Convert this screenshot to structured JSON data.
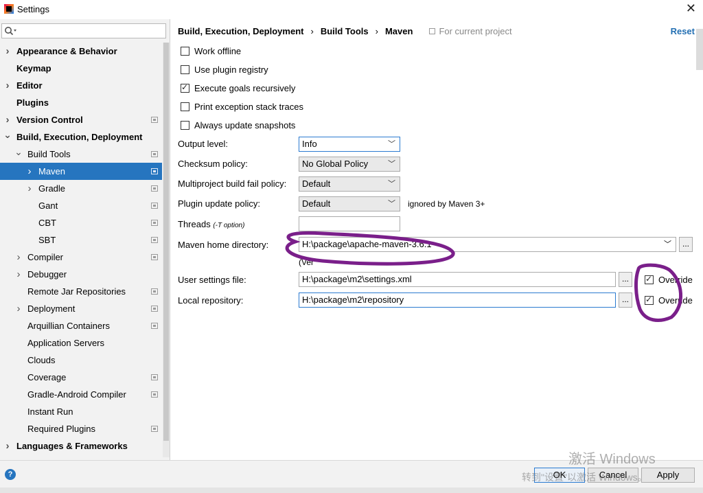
{
  "window": {
    "title": "Settings"
  },
  "search": {
    "placeholder": ""
  },
  "tree": [
    {
      "label": "Appearance & Behavior",
      "level": 0,
      "bold": true,
      "chevron": "right",
      "project": false
    },
    {
      "label": "Keymap",
      "level": 0,
      "bold": true,
      "chevron": "",
      "project": false
    },
    {
      "label": "Editor",
      "level": 0,
      "bold": true,
      "chevron": "right",
      "project": false
    },
    {
      "label": "Plugins",
      "level": 0,
      "bold": true,
      "chevron": "",
      "project": false
    },
    {
      "label": "Version Control",
      "level": 0,
      "bold": true,
      "chevron": "right",
      "project": true
    },
    {
      "label": "Build, Execution, Deployment",
      "level": 0,
      "bold": true,
      "chevron": "down",
      "project": false
    },
    {
      "label": "Build Tools",
      "level": 1,
      "bold": false,
      "chevron": "down",
      "project": true
    },
    {
      "label": "Maven",
      "level": 2,
      "bold": false,
      "chevron": "right",
      "project": true,
      "selected": true
    },
    {
      "label": "Gradle",
      "level": 2,
      "bold": false,
      "chevron": "right",
      "project": true
    },
    {
      "label": "Gant",
      "level": 2,
      "bold": false,
      "chevron": "",
      "project": true
    },
    {
      "label": "CBT",
      "level": 2,
      "bold": false,
      "chevron": "",
      "project": true
    },
    {
      "label": "SBT",
      "level": 2,
      "bold": false,
      "chevron": "",
      "project": true
    },
    {
      "label": "Compiler",
      "level": 1,
      "bold": false,
      "chevron": "right",
      "project": true
    },
    {
      "label": "Debugger",
      "level": 1,
      "bold": false,
      "chevron": "right",
      "project": false
    },
    {
      "label": "Remote Jar Repositories",
      "level": 1,
      "bold": false,
      "chevron": "",
      "project": true
    },
    {
      "label": "Deployment",
      "level": 1,
      "bold": false,
      "chevron": "right",
      "project": true
    },
    {
      "label": "Arquillian Containers",
      "level": 1,
      "bold": false,
      "chevron": "",
      "project": true
    },
    {
      "label": "Application Servers",
      "level": 1,
      "bold": false,
      "chevron": "",
      "project": false
    },
    {
      "label": "Clouds",
      "level": 1,
      "bold": false,
      "chevron": "",
      "project": false
    },
    {
      "label": "Coverage",
      "level": 1,
      "bold": false,
      "chevron": "",
      "project": true
    },
    {
      "label": "Gradle-Android Compiler",
      "level": 1,
      "bold": false,
      "chevron": "",
      "project": true
    },
    {
      "label": "Instant Run",
      "level": 1,
      "bold": false,
      "chevron": "",
      "project": false
    },
    {
      "label": "Required Plugins",
      "level": 1,
      "bold": false,
      "chevron": "",
      "project": true
    },
    {
      "label": "Languages & Frameworks",
      "level": 0,
      "bold": true,
      "chevron": "right",
      "project": false
    }
  ],
  "breadcrumb": {
    "items": [
      "Build, Execution, Deployment",
      "Build Tools",
      "Maven"
    ],
    "for_project": "For current project",
    "reset": "Reset"
  },
  "checkboxes": [
    {
      "label": "Work offline",
      "checked": false
    },
    {
      "label": "Use plugin registry",
      "checked": false
    },
    {
      "label": "Execute goals recursively",
      "checked": true
    },
    {
      "label": "Print exception stack traces",
      "checked": false
    },
    {
      "label": "Always update snapshots",
      "checked": false
    }
  ],
  "form": {
    "output_level": {
      "label": "Output level:",
      "value": "Info"
    },
    "checksum_policy": {
      "label": "Checksum policy:",
      "value": "No Global Policy"
    },
    "multiproject_policy": {
      "label": "Multiproject build fail policy:",
      "value": "Default"
    },
    "plugin_update_policy": {
      "label": "Plugin update policy:",
      "value": "Default",
      "note": "ignored by Maven 3+"
    },
    "threads": {
      "label": "Threads",
      "hint": "(-T option)",
      "value": ""
    },
    "maven_home": {
      "label": "Maven home directory:",
      "value": "H:\\package\\apache-maven-3.6.1",
      "version_note": "(Ver"
    },
    "user_settings": {
      "label": "User settings file:",
      "value": "H:\\package\\m2\\settings.xml",
      "override": "Override",
      "override_checked": true
    },
    "local_repo": {
      "label": "Local repository:",
      "value": "H:\\package\\m2\\repository",
      "override": "Override",
      "override_checked": true
    }
  },
  "buttons": {
    "ok": "OK",
    "cancel": "Cancel",
    "apply": "Apply",
    "browse": "..."
  },
  "watermark": {
    "line1": "激活 Windows",
    "line2": "转到\"设置\"以激活 Windows。"
  },
  "annotation_color": "#7a1f8a"
}
